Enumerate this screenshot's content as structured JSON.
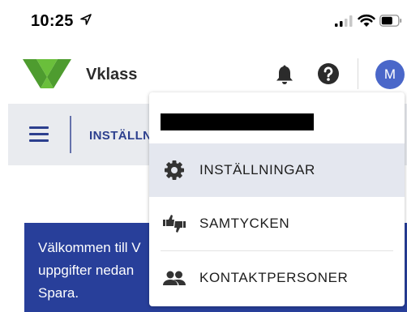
{
  "status_bar": {
    "time": "10:25",
    "icons": [
      "location-arrow-icon",
      "signal-icon",
      "wifi-icon",
      "battery-icon"
    ]
  },
  "header": {
    "logo_text": "Vklass",
    "icons": [
      "bell-icon",
      "help-icon"
    ],
    "avatar_initial": "M",
    "colors": {
      "logo_green": "#6abf3b",
      "avatar": "#4a67c9"
    }
  },
  "breadcrumb": {
    "menu_icon": "hamburger-icon",
    "current": "INSTÄLLN"
  },
  "banner": {
    "lines": [
      "Välkommen till V",
      "uppgifter nedan",
      "Spara."
    ],
    "color": "#283f9a"
  },
  "user_menu": {
    "items": [
      {
        "label": "INSTÄLLNINGAR",
        "icon": "gear-icon",
        "selected": true
      },
      {
        "label": "SAMTYCKEN",
        "icon": "thumbs-up-down-icon",
        "selected": false
      },
      {
        "label": "KONTAKTPERSONER",
        "icon": "people-icon",
        "selected": false
      }
    ]
  }
}
